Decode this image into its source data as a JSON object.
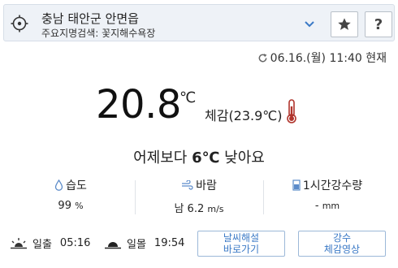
{
  "header": {
    "location": "충남 태안군 안면읍",
    "landmark": "주요지명검색: 꽃지해수욕장",
    "icons": {
      "locate": "crosshair-target-icon",
      "dropdown": "chevron-down-icon",
      "favorite": "star-icon",
      "help": "question-mark"
    },
    "help_label": "?"
  },
  "observation_time": "06.16.(월) 11:40 현재",
  "current": {
    "temperature": "20.8",
    "unit": "℃",
    "feels_like": "체감(23.9℃)",
    "comparison_prefix": "어제보다",
    "comparison_value": "6℃",
    "comparison_suffix": "낮아요"
  },
  "stats": [
    {
      "label": "습도",
      "value": "99",
      "unit": "%",
      "icon": "droplet-icon"
    },
    {
      "label": "바람",
      "value": "남 6.2",
      "unit": "m/s",
      "icon": "wind-icon"
    },
    {
      "label": "1시간강수량",
      "value": "-",
      "unit": "mm",
      "icon": "rain-gauge-icon"
    }
  ],
  "sun": {
    "sunrise_label": "일출",
    "sunrise_time": "05:16",
    "sunset_label": "일몰",
    "sunset_time": "19:54"
  },
  "buttons": {
    "beach_line1": "날씨해설",
    "beach_line2": "바로가기",
    "video_line1": "강수",
    "video_line2": "체감영상"
  },
  "colors": {
    "accent": "#3a79c6",
    "thermo": "#b0342c",
    "header_bg": "#eef2f7"
  }
}
